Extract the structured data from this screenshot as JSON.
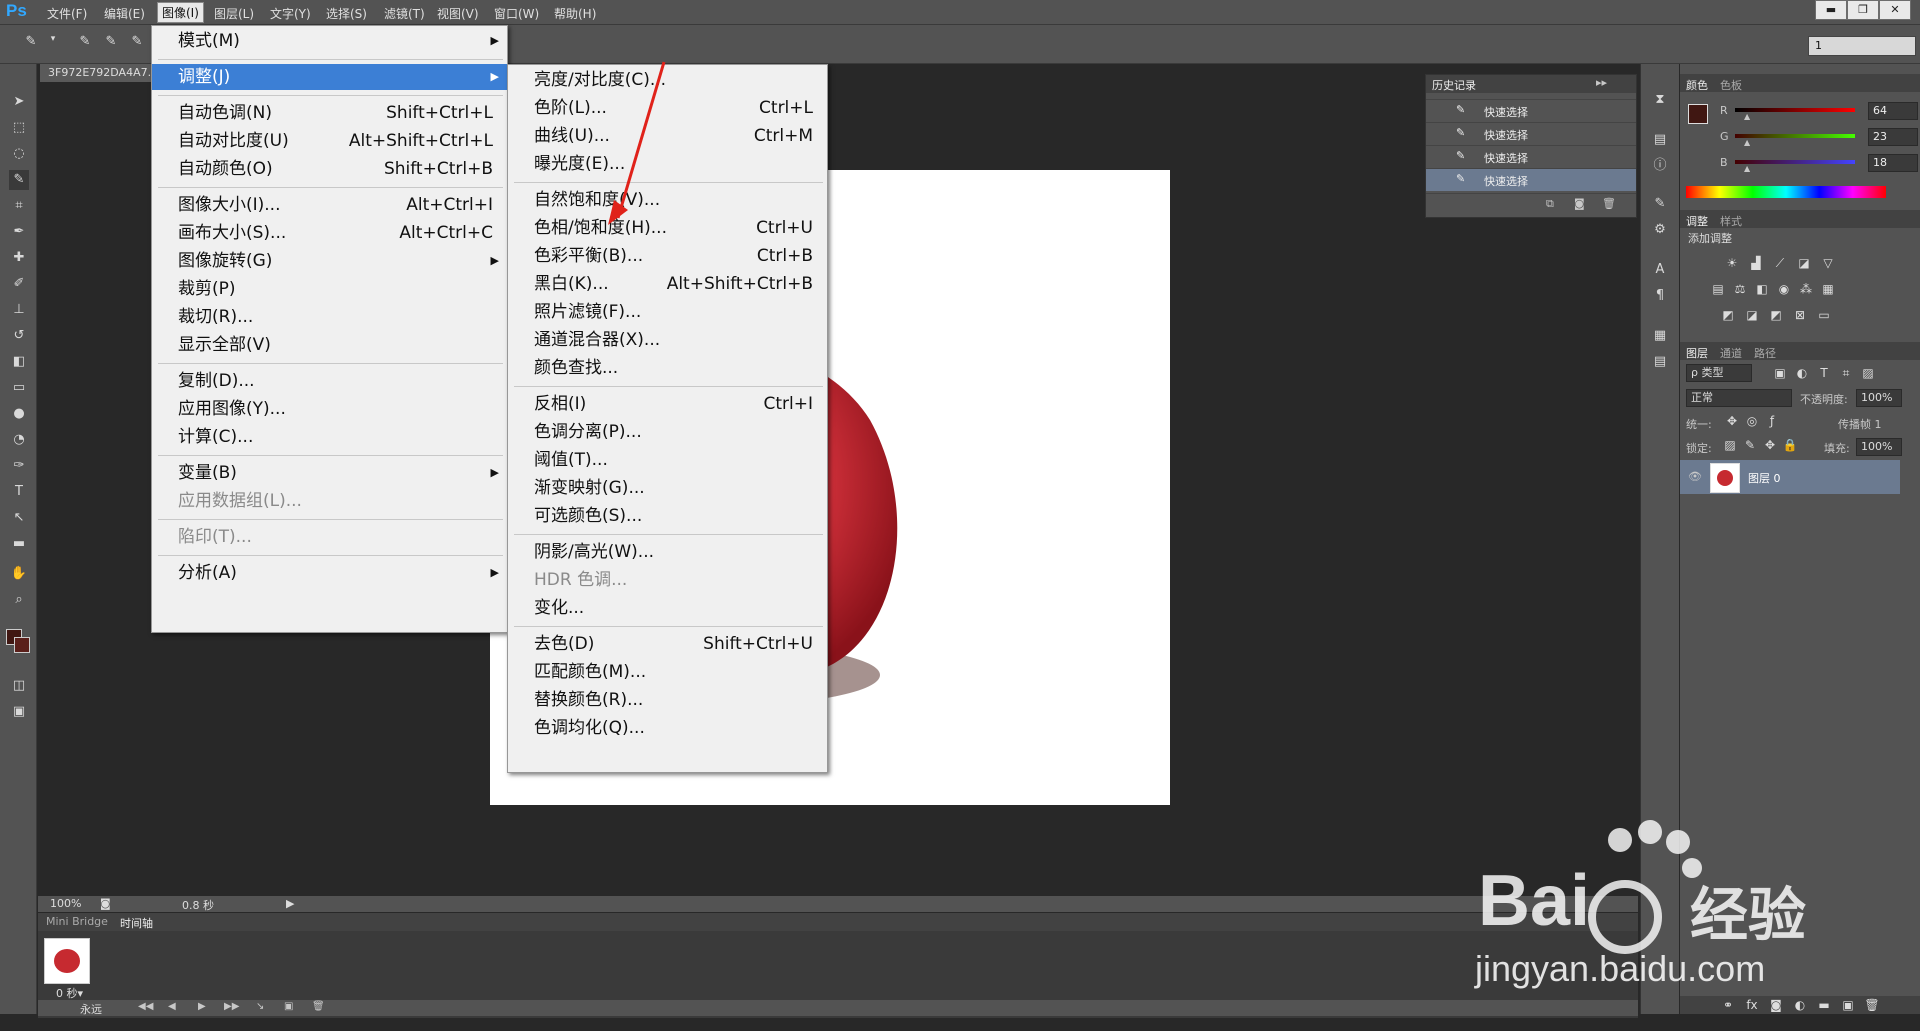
{
  "app": {
    "logo": "Ps"
  },
  "menubar": {
    "items": [
      "文件(F)",
      "编辑(E)",
      "图像(I)",
      "图层(L)",
      "文字(Y)",
      "选择(S)",
      "滤镜(T)",
      "视图(V)",
      "窗口(W)",
      "帮助(H)"
    ],
    "active_index": 2
  },
  "window_controls": {
    "minimize": "▬",
    "restore": "❐",
    "close": "✕"
  },
  "options_bar": {
    "value": "1"
  },
  "document": {
    "tab_title": "3F972E792DA4A7..."
  },
  "status": {
    "zoom": "100%",
    "time": "0.8 秒"
  },
  "timeline": {
    "tabs": [
      "Mini Bridge",
      "时间轴"
    ],
    "frame_delay": "0 秒▾",
    "loop": "永远"
  },
  "history_panel": {
    "title": "历史记录",
    "rows": [
      "快速选择",
      "快速选择",
      "快速选择",
      "快速选择"
    ],
    "selected_index": 3
  },
  "color_panel": {
    "tabs": [
      "颜色",
      "色板"
    ],
    "channels": [
      {
        "label": "R",
        "value": "64"
      },
      {
        "label": "G",
        "value": "23"
      },
      {
        "label": "B",
        "value": "18"
      }
    ],
    "color": "#401712"
  },
  "adjust_panel": {
    "tabs": [
      "调整",
      "样式"
    ],
    "title": "添加调整"
  },
  "layers_panel": {
    "tabs": [
      "图层",
      "通道",
      "路径"
    ],
    "filter": "ρ 类型",
    "blend": "正常",
    "opacity_label": "不透明度:",
    "opacity": "100%",
    "unify_label": "统一:",
    "propagate_label": "传播帧 1",
    "lock_label": "锁定:",
    "fill_label": "填充:",
    "fill": "100%",
    "layer_name": "图层 0"
  },
  "image_menu": {
    "items": [
      {
        "label": "模式(M)",
        "shortcut": "",
        "submenu": true
      },
      {
        "sep": true
      },
      {
        "label": "调整(J)",
        "shortcut": "",
        "submenu": true,
        "highlight": true
      },
      {
        "sep": true
      },
      {
        "label": "自动色调(N)",
        "shortcut": "Shift+Ctrl+L"
      },
      {
        "label": "自动对比度(U)",
        "shortcut": "Alt+Shift+Ctrl+L"
      },
      {
        "label": "自动颜色(O)",
        "shortcut": "Shift+Ctrl+B"
      },
      {
        "sep": true
      },
      {
        "label": "图像大小(I)...",
        "shortcut": "Alt+Ctrl+I"
      },
      {
        "label": "画布大小(S)...",
        "shortcut": "Alt+Ctrl+C"
      },
      {
        "label": "图像旋转(G)",
        "shortcut": "",
        "submenu": true
      },
      {
        "label": "裁剪(P)",
        "shortcut": ""
      },
      {
        "label": "裁切(R)...",
        "shortcut": ""
      },
      {
        "label": "显示全部(V)",
        "shortcut": ""
      },
      {
        "sep": true
      },
      {
        "label": "复制(D)...",
        "shortcut": ""
      },
      {
        "label": "应用图像(Y)...",
        "shortcut": ""
      },
      {
        "label": "计算(C)...",
        "shortcut": ""
      },
      {
        "sep": true
      },
      {
        "label": "变量(B)",
        "shortcut": "",
        "submenu": true
      },
      {
        "label": "应用数据组(L)...",
        "shortcut": "",
        "disabled": true
      },
      {
        "sep": true
      },
      {
        "label": "陷印(T)...",
        "shortcut": "",
        "disabled": true
      },
      {
        "sep": true
      },
      {
        "label": "分析(A)",
        "shortcut": "",
        "submenu": true
      }
    ]
  },
  "adjust_menu": {
    "items": [
      {
        "label": "亮度/对比度(C)...",
        "shortcut": ""
      },
      {
        "label": "色阶(L)...",
        "shortcut": "Ctrl+L"
      },
      {
        "label": "曲线(U)...",
        "shortcut": "Ctrl+M"
      },
      {
        "label": "曝光度(E)...",
        "shortcut": ""
      },
      {
        "sep": true
      },
      {
        "label": "自然饱和度(V)...",
        "shortcut": ""
      },
      {
        "label": "色相/饱和度(H)...",
        "shortcut": "Ctrl+U"
      },
      {
        "label": "色彩平衡(B)...",
        "shortcut": "Ctrl+B"
      },
      {
        "label": "黑白(K)...",
        "shortcut": "Alt+Shift+Ctrl+B"
      },
      {
        "label": "照片滤镜(F)...",
        "shortcut": ""
      },
      {
        "label": "通道混合器(X)...",
        "shortcut": ""
      },
      {
        "label": "颜色查找...",
        "shortcut": ""
      },
      {
        "sep": true
      },
      {
        "label": "反相(I)",
        "shortcut": "Ctrl+I"
      },
      {
        "label": "色调分离(P)...",
        "shortcut": ""
      },
      {
        "label": "阈值(T)...",
        "shortcut": ""
      },
      {
        "label": "渐变映射(G)...",
        "shortcut": ""
      },
      {
        "label": "可选颜色(S)...",
        "shortcut": ""
      },
      {
        "sep": true
      },
      {
        "label": "阴影/高光(W)...",
        "shortcut": ""
      },
      {
        "label": "HDR 色调...",
        "shortcut": "",
        "disabled": true
      },
      {
        "label": "变化...",
        "shortcut": ""
      },
      {
        "sep": true
      },
      {
        "label": "去色(D)",
        "shortcut": "Shift+Ctrl+U"
      },
      {
        "label": "匹配颜色(M)...",
        "shortcut": ""
      },
      {
        "label": "替换颜色(R)...",
        "shortcut": ""
      },
      {
        "label": "色调均化(Q)...",
        "shortcut": ""
      }
    ]
  },
  "watermark": {
    "brand": "Bai",
    "brand2": "经验",
    "url": "jingyan.baidu.com"
  }
}
